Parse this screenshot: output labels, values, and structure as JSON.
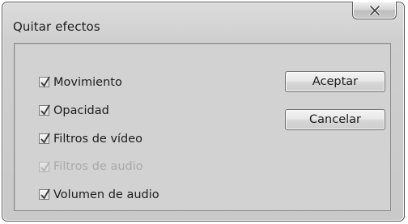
{
  "window": {
    "title": "Quitar efectos"
  },
  "titlebar": {
    "close_icon": "close-icon"
  },
  "effects": [
    {
      "label": "Movimiento",
      "checked": true,
      "enabled": true
    },
    {
      "label": "Opacidad",
      "checked": true,
      "enabled": true
    },
    {
      "label": "Filtros de vídeo",
      "checked": true,
      "enabled": true
    },
    {
      "label": "Filtros de audio",
      "checked": true,
      "enabled": false
    },
    {
      "label": "Volumen de audio",
      "checked": true,
      "enabled": true
    }
  ],
  "buttons": {
    "accept_label": "Aceptar",
    "cancel_label": "Cancelar"
  }
}
